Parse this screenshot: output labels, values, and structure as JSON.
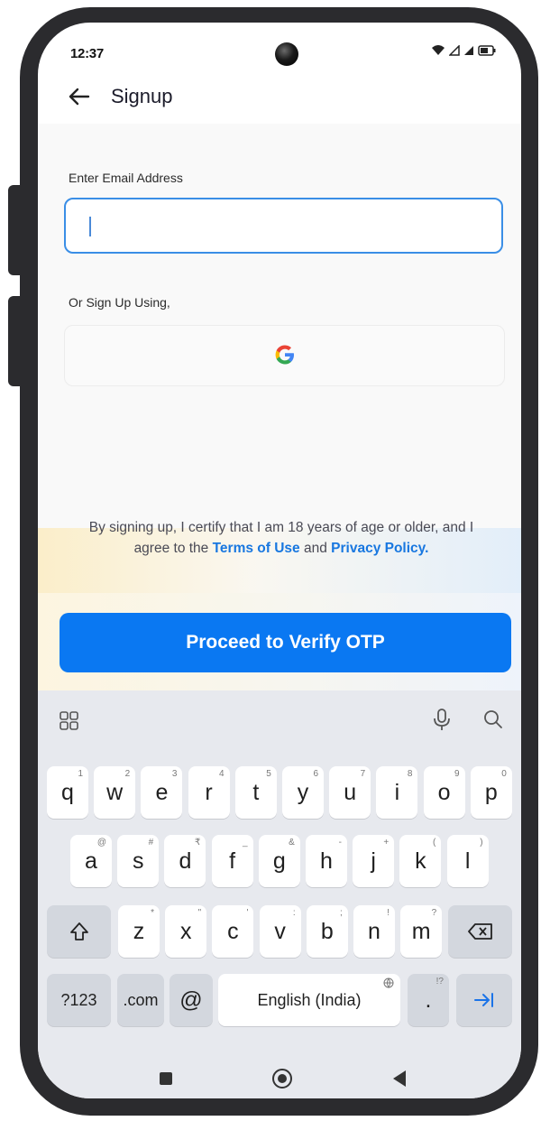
{
  "status_bar": {
    "time": "12:37"
  },
  "app_bar": {
    "title": "Signup",
    "back_icon": "arrow-left-icon"
  },
  "form": {
    "email_label": "Enter Email Address",
    "email_value": "",
    "alt_signup_label": "Or Sign Up Using,",
    "google_icon": "google-icon"
  },
  "terms": {
    "prefix": "By signing up, I certify that I am 18 years of age or older, and I agree to the ",
    "terms_link": "Terms of Use",
    "and": " and ",
    "privacy_link": "Privacy Policy."
  },
  "cta": {
    "label": "Proceed to Verify OTP",
    "color": "#0a78f2"
  },
  "keyboard": {
    "row1": [
      {
        "k": "q",
        "h": "1"
      },
      {
        "k": "w",
        "h": "2"
      },
      {
        "k": "e",
        "h": "3"
      },
      {
        "k": "r",
        "h": "4"
      },
      {
        "k": "t",
        "h": "5"
      },
      {
        "k": "y",
        "h": "6"
      },
      {
        "k": "u",
        "h": "7"
      },
      {
        "k": "i",
        "h": "8"
      },
      {
        "k": "o",
        "h": "9"
      },
      {
        "k": "p",
        "h": "0"
      }
    ],
    "row2": [
      {
        "k": "a",
        "h": "@"
      },
      {
        "k": "s",
        "h": "#"
      },
      {
        "k": "d",
        "h": "₹"
      },
      {
        "k": "f",
        "h": "_"
      },
      {
        "k": "g",
        "h": "&"
      },
      {
        "k": "h",
        "h": "-"
      },
      {
        "k": "j",
        "h": "+"
      },
      {
        "k": "k",
        "h": "("
      },
      {
        "k": "l",
        "h": ")"
      }
    ],
    "row3": [
      {
        "k": "z",
        "h": "*"
      },
      {
        "k": "x",
        "h": "\""
      },
      {
        "k": "c",
        "h": "'"
      },
      {
        "k": "v",
        "h": ":"
      },
      {
        "k": "b",
        "h": ";"
      },
      {
        "k": "n",
        "h": "!"
      },
      {
        "k": "m",
        "h": "?"
      }
    ],
    "shift_icon": "shift-icon",
    "backspace_icon": "backspace-icon",
    "symbols": "?123",
    "dotcom": ".com",
    "at": "@",
    "space": "English (India)",
    "period": ".",
    "period_hint": "!?",
    "enter_icon": "tab-next-icon",
    "colors": {
      "key_bg": "#ffffff",
      "func_bg": "#d3d7de",
      "enter_text": "#1a73e8"
    }
  },
  "nav": {
    "square": "recent-apps-icon",
    "circle": "home-icon",
    "triangle": "back-nav-icon"
  }
}
